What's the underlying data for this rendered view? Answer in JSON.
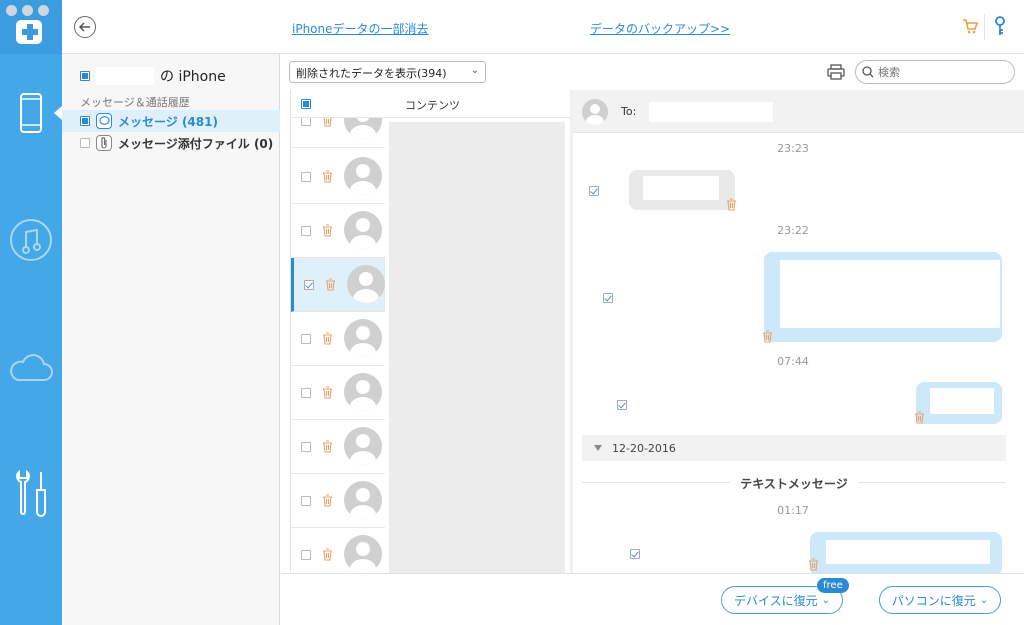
{
  "header": {
    "partial_erase_link": "iPhoneデータの一部消去",
    "backup_link": "データのバックアップ>>"
  },
  "sidebar": {
    "device_label": "の iPhone",
    "section_label": "メッセージ＆通話履歴",
    "items": [
      {
        "label": "メッセージ (481)"
      },
      {
        "label": "メッセージ添付ファイル (0)"
      }
    ]
  },
  "toolbar": {
    "filter_value": "削除されたデータを表示(394)",
    "search_placeholder": "検索"
  },
  "list": {
    "header_label": "コンテンツ"
  },
  "conversation": {
    "to_label": "To:",
    "times": [
      "23:23",
      "23:22",
      "07:44",
      "01:17"
    ],
    "date": "12-20-2016",
    "section_title": "テキストメッセージ"
  },
  "footer": {
    "restore_device": "デバイスに復元",
    "restore_pc": "パソコンに復元",
    "free_badge": "free"
  },
  "colors": {
    "rail": "#43a7e8",
    "accent": "#2a8ad4",
    "trash": "#e8a36b",
    "cart": "#e8a23a"
  }
}
